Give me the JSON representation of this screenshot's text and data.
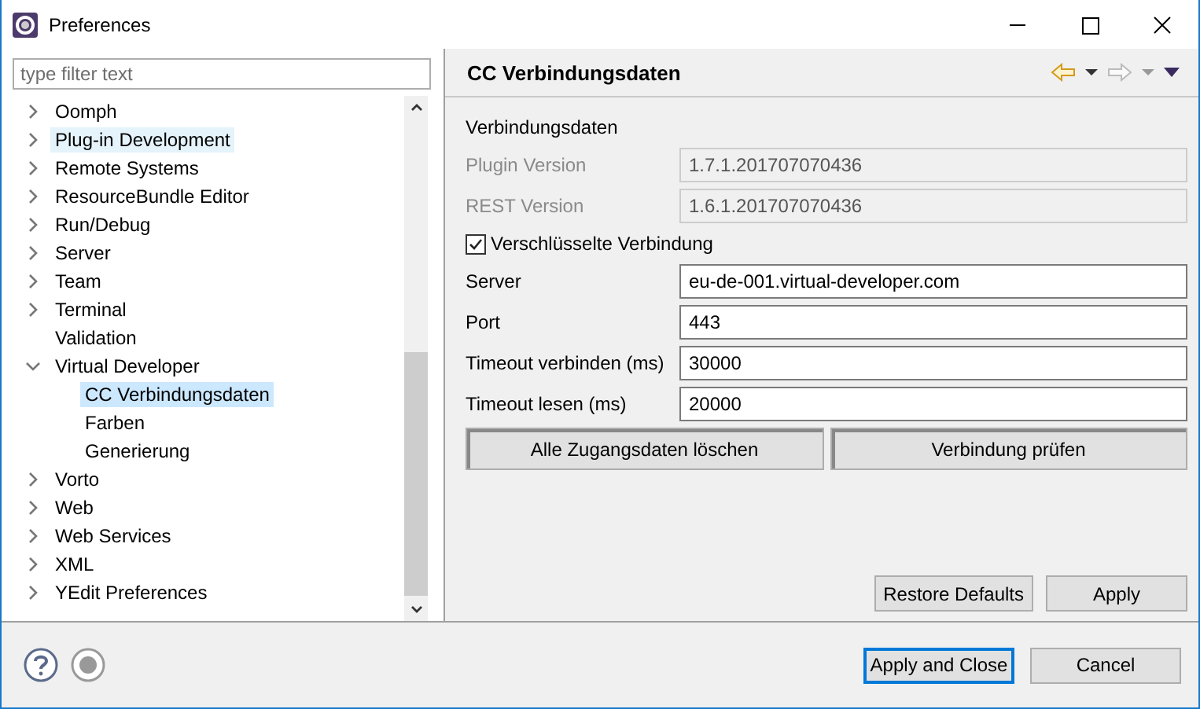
{
  "window": {
    "title": "Preferences"
  },
  "filter": {
    "placeholder": "type filter text"
  },
  "tree": [
    {
      "label": "Oomph",
      "kind": "folder",
      "expanded": false,
      "selected": false
    },
    {
      "label": "Plug-in Development",
      "kind": "folder",
      "expanded": false,
      "selected": false,
      "hover": true
    },
    {
      "label": "Remote Systems",
      "kind": "folder",
      "expanded": false,
      "selected": false
    },
    {
      "label": "ResourceBundle Editor",
      "kind": "folder",
      "expanded": false,
      "selected": false
    },
    {
      "label": "Run/Debug",
      "kind": "folder",
      "expanded": false,
      "selected": false
    },
    {
      "label": "Server",
      "kind": "folder",
      "expanded": false,
      "selected": false
    },
    {
      "label": "Team",
      "kind": "folder",
      "expanded": false,
      "selected": false
    },
    {
      "label": "Terminal",
      "kind": "folder",
      "expanded": false,
      "selected": false
    },
    {
      "label": "Validation",
      "kind": "leaf",
      "selected": false
    },
    {
      "label": "Virtual Developer",
      "kind": "folder",
      "expanded": true,
      "selected": false,
      "children": [
        {
          "label": "CC Verbindungsdaten",
          "kind": "leaf",
          "selected": true
        },
        {
          "label": "Farben",
          "kind": "leaf",
          "selected": false
        },
        {
          "label": "Generierung",
          "kind": "leaf",
          "selected": false
        }
      ]
    },
    {
      "label": "Vorto",
      "kind": "folder",
      "expanded": false,
      "selected": false
    },
    {
      "label": "Web",
      "kind": "folder",
      "expanded": false,
      "selected": false
    },
    {
      "label": "Web Services",
      "kind": "folder",
      "expanded": false,
      "selected": false
    },
    {
      "label": "XML",
      "kind": "folder",
      "expanded": false,
      "selected": false
    },
    {
      "label": "YEdit Preferences",
      "kind": "folder",
      "expanded": false,
      "selected": false
    }
  ],
  "page": {
    "title": "CC Verbindungsdaten",
    "rows": [
      {
        "kind": "heading",
        "label": "Verbindungsdaten"
      },
      {
        "kind": "field",
        "label": "Plugin Version",
        "value": "1.7.1.201707070436",
        "disabled": true
      },
      {
        "kind": "field",
        "label": "REST Version",
        "value": "1.6.1.201707070436",
        "disabled": true
      },
      {
        "kind": "checkbox",
        "label": "Verschlüsselte Verbindung",
        "checked": true
      },
      {
        "kind": "field",
        "label": "Server",
        "value": "eu-de-001.virtual-developer.com",
        "disabled": false
      },
      {
        "kind": "field",
        "label": "Port",
        "value": "443",
        "disabled": false
      },
      {
        "kind": "field",
        "label": "Timeout verbinden (ms)",
        "value": "30000",
        "disabled": false
      },
      {
        "kind": "field",
        "label": "Timeout lesen (ms)",
        "value": "20000",
        "disabled": false
      }
    ],
    "actions": [
      "Alle Zugangsdaten löschen",
      "Verbindung prüfen"
    ],
    "page_buttons": [
      "Restore Defaults",
      "Apply"
    ]
  },
  "dialog_buttons": [
    {
      "label": "Apply and Close",
      "default": true
    },
    {
      "label": "Cancel",
      "default": false
    }
  ]
}
